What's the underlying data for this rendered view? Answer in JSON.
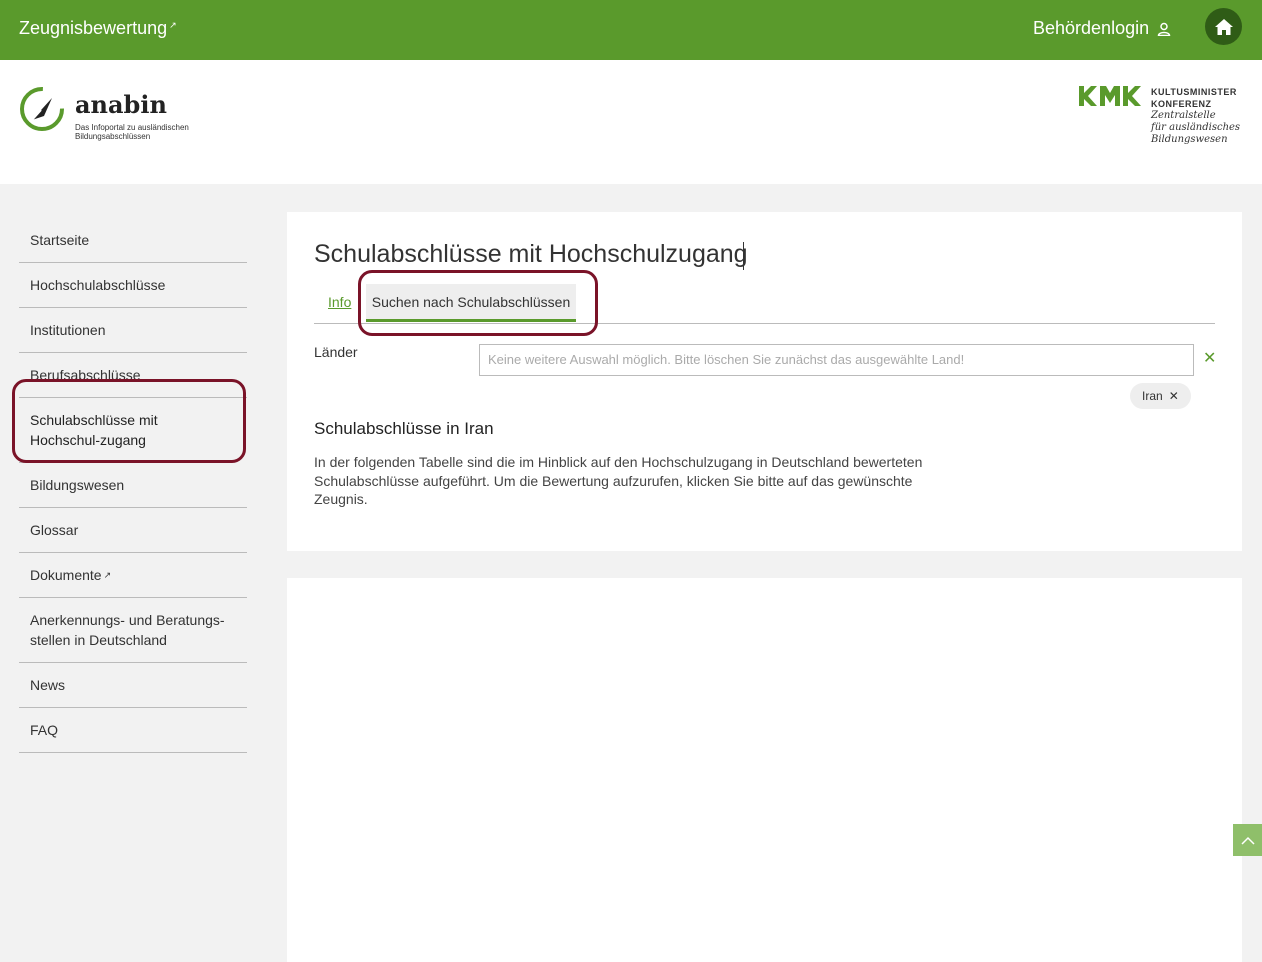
{
  "topbar": {
    "brand_label": "Zeugnisbewertung",
    "login_label": "Behördenlogin",
    "colors": {
      "bar": "#5a9a2c",
      "home_bg": "#2f5c16"
    }
  },
  "header": {
    "logo_name": "anabin",
    "logo_subtitle": "Das Infoportal zu ausländischen Bildungsabschlüssen",
    "kmk_line1": "KULTUSMINISTER",
    "kmk_line2": "KONFERENZ",
    "kmk_line3": "Zentralstelle",
    "kmk_line4": "für ausländisches",
    "kmk_line5": "Bildungswesen"
  },
  "sidebar": {
    "items": [
      {
        "label": "Startseite"
      },
      {
        "label": "Hochschulabschlüsse"
      },
      {
        "label": "Institutionen"
      },
      {
        "label": "Berufsabschlüsse"
      },
      {
        "label": "Schulabschlüsse mit Hochschul-zugang"
      },
      {
        "label": "Bildungswesen"
      },
      {
        "label": "Glossar"
      },
      {
        "label": "Dokumente"
      },
      {
        "label": "Anerkennungs- und Beratungs-stellen in Deutschland"
      },
      {
        "label": "News"
      },
      {
        "label": "FAQ"
      }
    ]
  },
  "main": {
    "title": "Schulabschlüsse mit Hochschulzugang",
    "tabs": [
      {
        "label": "Info"
      },
      {
        "label": "Suchen nach Schulabschlüssen"
      }
    ],
    "filter": {
      "label": "Länder",
      "placeholder": "Keine weitere Auswahl möglich. Bitte löschen Sie zunächst das ausgewählte Land!",
      "selected_chip": "Iran"
    },
    "section_title": "Schulabschlüsse in Iran",
    "section_text": "In der folgenden Tabelle sind die im Hinblick auf den Hochschulzugang in Deutschland bewerteten Schulabschlüsse aufgeführt. Um die Bewertung aufzurufen, klicken Sie bitte auf das gewünschte Zeugnis."
  },
  "highlight_color": "#7a1328"
}
